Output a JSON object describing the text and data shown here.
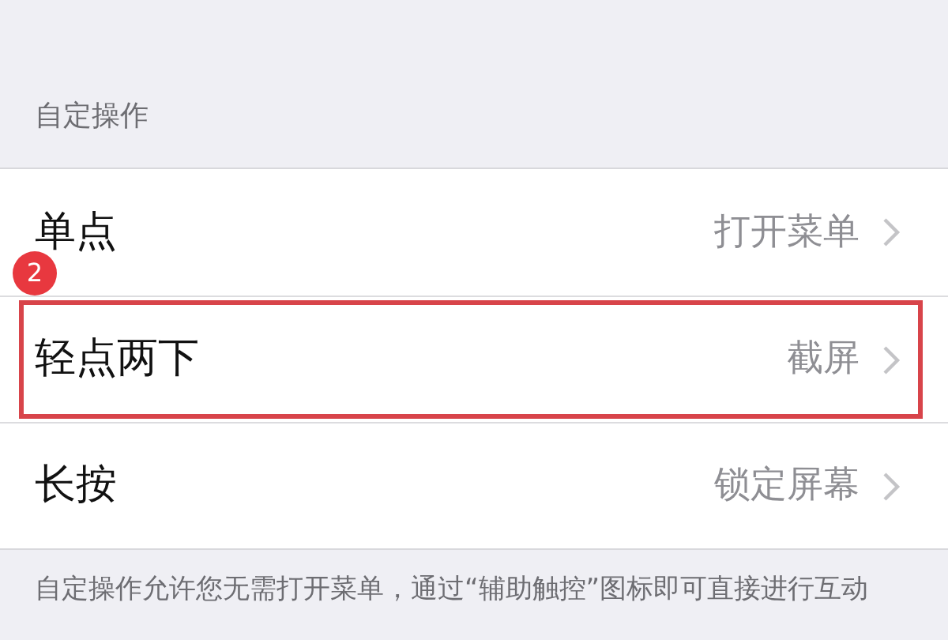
{
  "section_header": "自定操作",
  "rows": [
    {
      "label": "单点",
      "value": "打开菜单",
      "highlighted": false
    },
    {
      "label": "轻点两下",
      "value": "截屏",
      "highlighted": true
    },
    {
      "label": "长按",
      "value": "锁定屏幕",
      "highlighted": false
    }
  ],
  "annotation": {
    "number": "2"
  },
  "footer": "自定操作允许您无需打开菜单，通过“辅助触控”图标即可直接进行互动"
}
